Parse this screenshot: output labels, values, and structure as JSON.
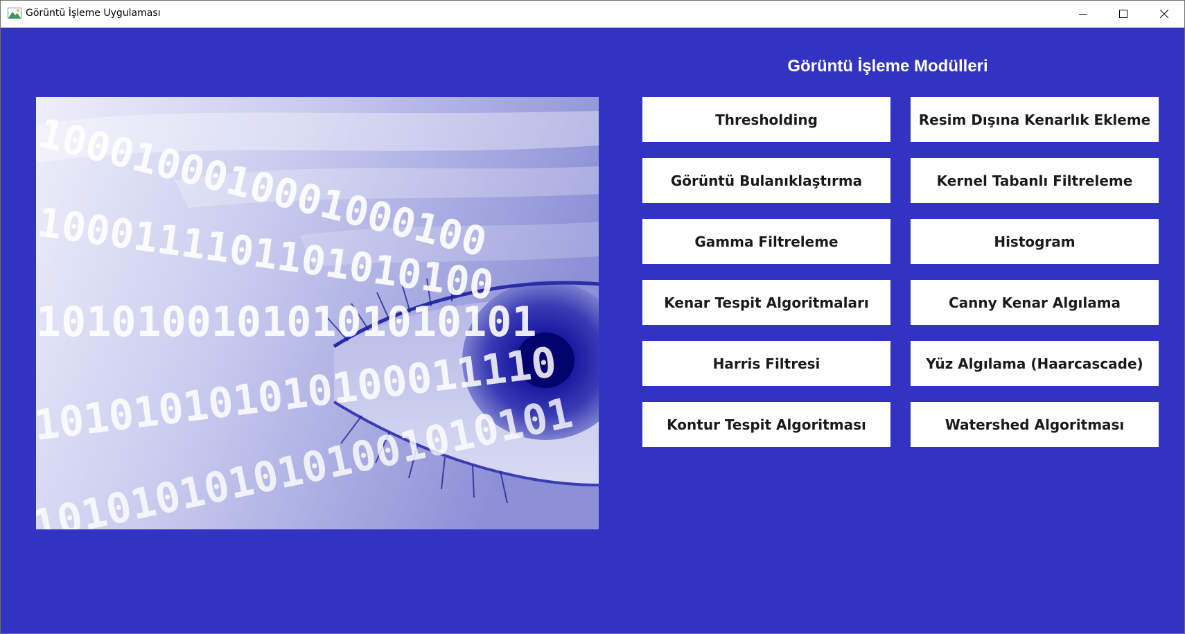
{
  "window": {
    "title": "Görüntü İşleme Uygulaması",
    "background_color": "#3333c3"
  },
  "main": {
    "heading": "Görüntü İşleme Modülleri",
    "banner_image": "binary-eye-image",
    "modules": [
      {
        "label": "Thresholding"
      },
      {
        "label": "Resim Dışına Kenarlık Ekleme"
      },
      {
        "label": "Görüntü Bulanıklaştırma"
      },
      {
        "label": "Kernel Tabanlı Filtreleme"
      },
      {
        "label": "Gamma Filtreleme"
      },
      {
        "label": "Histogram"
      },
      {
        "label": "Kenar Tespit Algoritmaları"
      },
      {
        "label": "Canny Kenar Algılama"
      },
      {
        "label": "Harris Filtresi"
      },
      {
        "label": "Yüz Algılama (Haarcascade)"
      },
      {
        "label": "Kontur Tespit Algoritması"
      },
      {
        "label": "Watershed Algoritması"
      }
    ]
  }
}
